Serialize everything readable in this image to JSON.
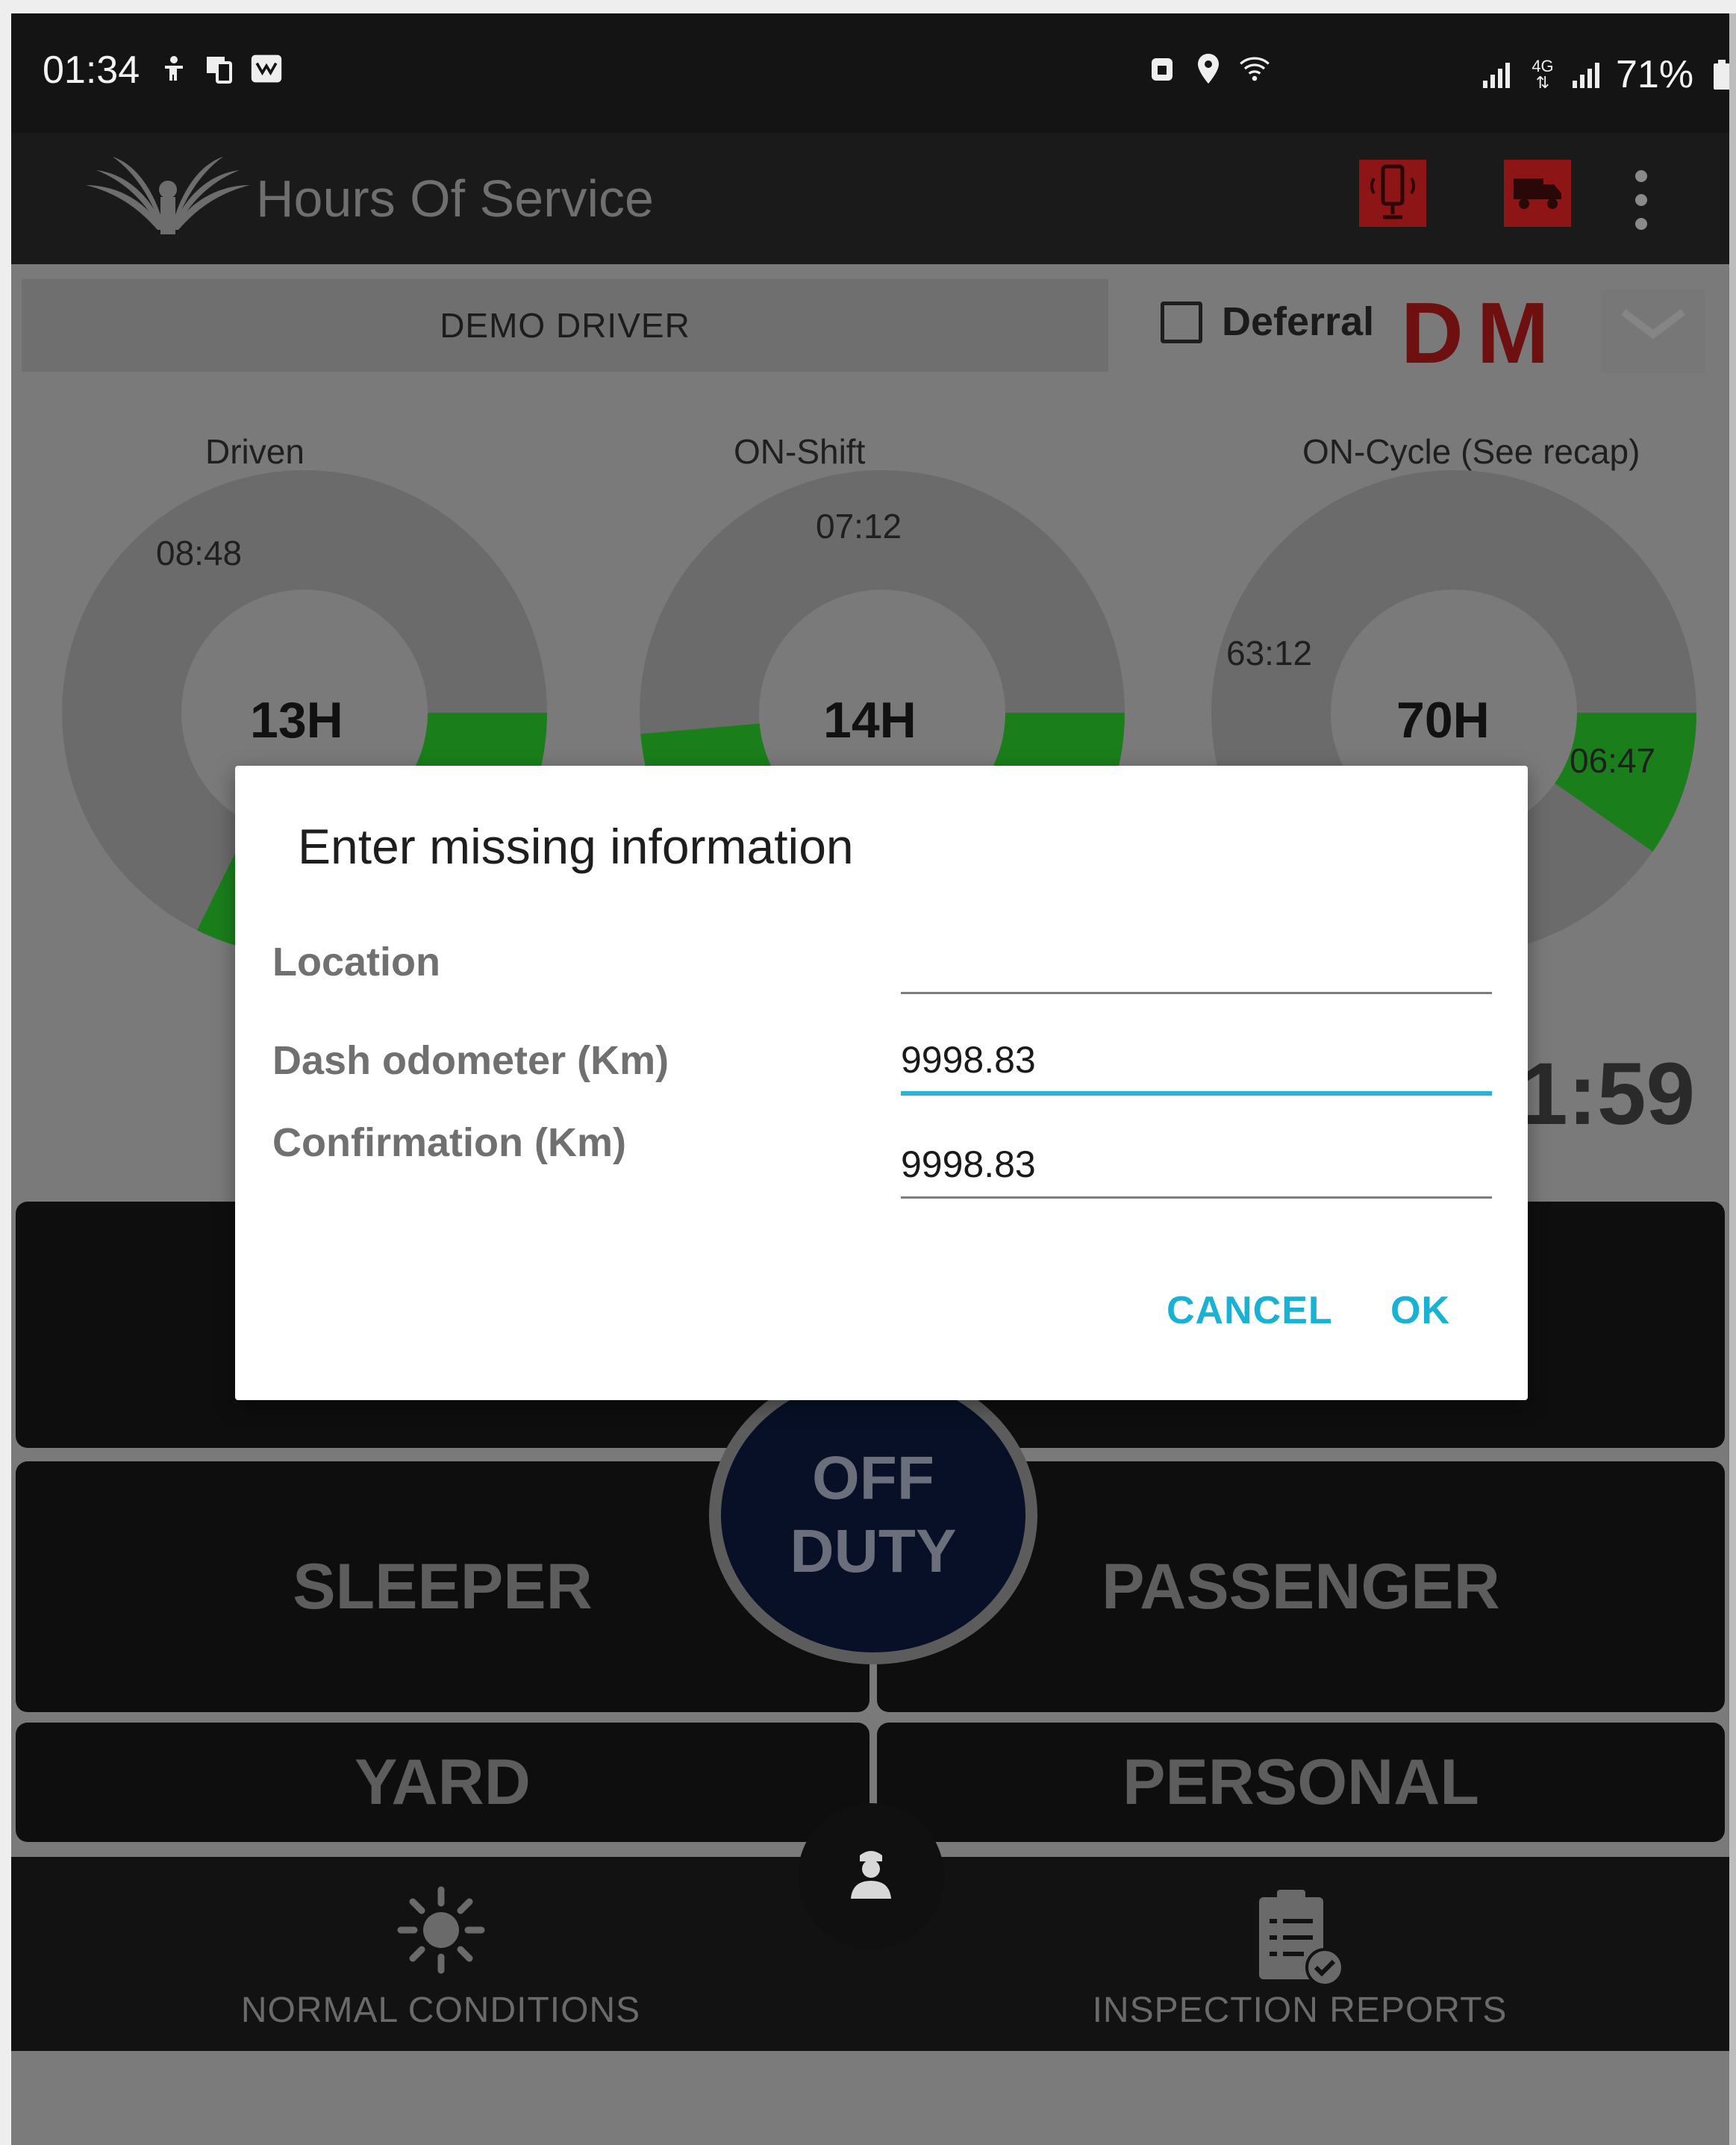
{
  "status_bar": {
    "time": "01:34",
    "battery": "71%",
    "network": "4G"
  },
  "app_bar": {
    "title": "Hours Of Service"
  },
  "driver": {
    "name": "DEMO DRIVER",
    "deferral_label": "Deferral",
    "deferral_checked": false,
    "mode_letters": "DM"
  },
  "gauges": [
    {
      "label": "Driven",
      "total": "13H",
      "value": "08:48",
      "fraction": 0.677
    },
    {
      "label": "ON-Shift",
      "total": "14H",
      "value": "07:12",
      "fraction": 0.514
    },
    {
      "label": "ON-Cycle (See recap)",
      "total": "70H",
      "value": "63:12",
      "secondary_value": "06:47",
      "fraction": 0.903
    }
  ],
  "clock_partial": "1:59",
  "duty_buttons": {
    "off_duty_line1": "OFF",
    "off_duty_line2": "DUTY",
    "sleeper": "SLEEPER",
    "passenger": "PASSENGER",
    "yard": "YARD",
    "personal": "PERSONAL"
  },
  "bottom_nav": {
    "conditions": "NORMAL CONDITIONS",
    "inspection": "INSPECTION REPORTS"
  },
  "dialog": {
    "title": "Enter missing information",
    "location_label": "Location",
    "location_value": "",
    "odometer_label": "Dash odometer (Km)",
    "odometer_value": "9998.83",
    "confirmation_label": "Confirmation (Km)",
    "confirmation_value": "9998.83",
    "cancel": "CANCEL",
    "ok": "OK"
  },
  "colors": {
    "accent": "#1ab2d4",
    "donut_progress": "#1a7f1a",
    "alert_red": "#8e1515"
  }
}
